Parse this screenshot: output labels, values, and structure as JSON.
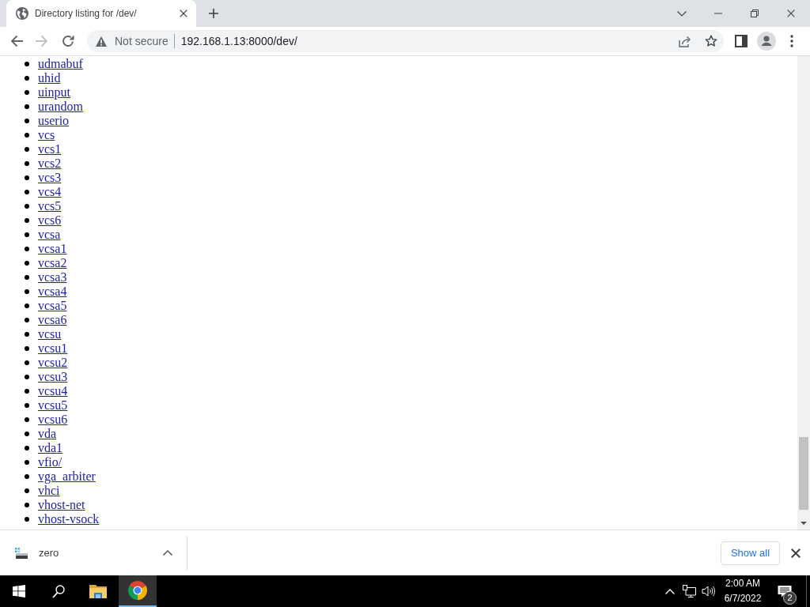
{
  "tabs": [
    {
      "title": "Directory listing for /dev/",
      "selected": true
    }
  ],
  "nav_buttons": [
    {
      "kind": "back",
      "disabled": false
    },
    {
      "kind": "forward",
      "disabled": true
    },
    {
      "kind": "reload",
      "disabled": false
    }
  ],
  "address_bar": {
    "security_label": "Not secure",
    "url": "192.168.1.13:8000/dev/"
  },
  "page": {
    "entries": [
      "udmabuf",
      "uhid",
      "uinput",
      "urandom",
      "userio",
      "vcs",
      "vcs1",
      "vcs2",
      "vcs3",
      "vcs4",
      "vcs5",
      "vcs6",
      "vcsa",
      "vcsa1",
      "vcsa2",
      "vcsa3",
      "vcsa4",
      "vcsa5",
      "vcsa6",
      "vcsu",
      "vcsu1",
      "vcsu2",
      "vcsu3",
      "vcsu4",
      "vcsu5",
      "vcsu6",
      "vda",
      "vda1",
      "vfio/",
      "vga_arbiter",
      "vhci",
      "vhost-net",
      "vhost-vsock"
    ]
  },
  "download_bar": {
    "items": [
      {
        "name": "zero"
      }
    ],
    "show_all": "Show all"
  },
  "taskbar": {
    "apps": [
      {
        "kind": "start",
        "selected": false
      },
      {
        "kind": "search",
        "selected": false
      },
      {
        "kind": "file-explorer",
        "selected": false
      },
      {
        "kind": "browser",
        "selected": true
      }
    ]
  },
  "tray": {
    "time": "2:00 AM",
    "date": "6/7/2022",
    "notification_count": "2"
  }
}
